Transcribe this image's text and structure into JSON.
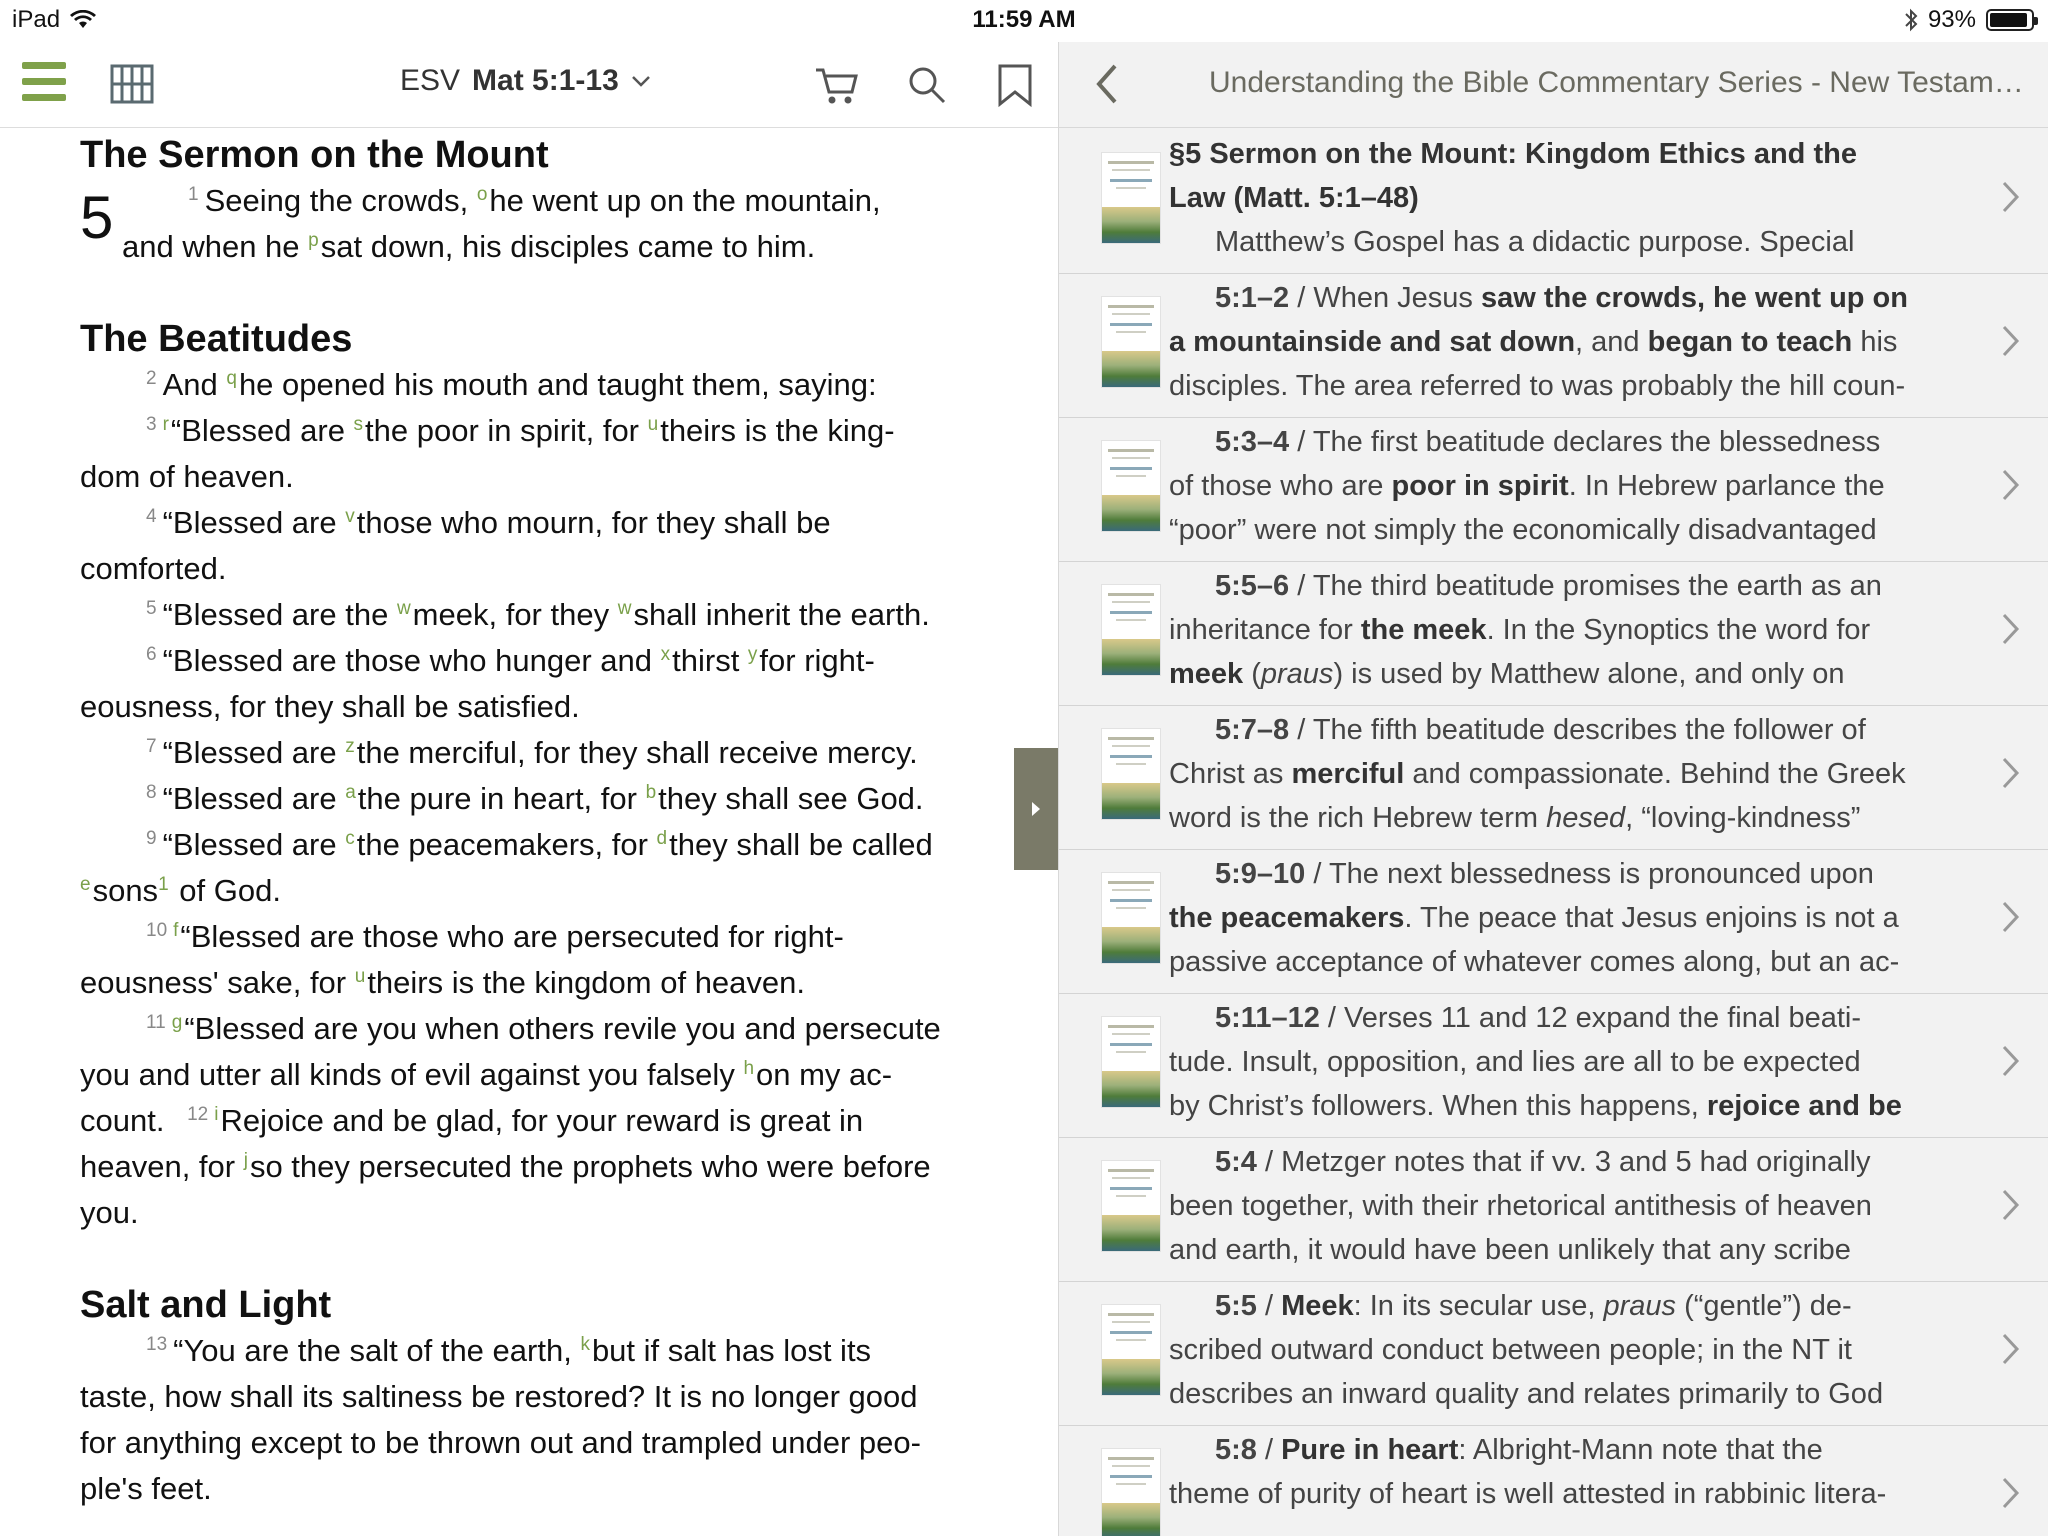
{
  "status_bar": {
    "device": "iPad",
    "time": "11:59 AM",
    "battery": "93%",
    "battery_level": 0.93
  },
  "left_toolbar": {
    "version": "ESV",
    "reference": "Mat 5:1-13"
  },
  "bible": {
    "heading1": "The Sermon on the Mount",
    "chapter": "5",
    "v1_num": "1",
    "v1_a": "Seeing the crowds, ",
    "v1_fn1": "o",
    "v1_b": "he went up on the mountain,",
    "v1_c": "and when he ",
    "v1_fn2": "p",
    "v1_d": "sat down, his disciples came to him.",
    "heading2": "The Beatitudes",
    "v2_num": "2",
    "v2_a": "And ",
    "v2_fn": "q",
    "v2_b": "he opened his mouth and taught them, saying:",
    "v3_num": "3",
    "v3_fn1": "r",
    "v3_a": "“Blessed are ",
    "v3_fn2": "s",
    "v3_b": "the poor in spirit, for ",
    "v3_fn3": "u",
    "v3_c": "theirs is the king-",
    "v3_d": "dom of heaven.",
    "v4_num": "4",
    "v4_a": "“Blessed are ",
    "v4_fn": "v",
    "v4_b": "those who mourn, for they shall be",
    "v4_c": "comforted.",
    "v5_num": "5",
    "v5_a": "“Blessed are the ",
    "v5_fn1": "w",
    "v5_b": "meek, for they ",
    "v5_fn2": "w",
    "v5_c": "shall inherit the earth.",
    "v6_num": "6",
    "v6_a": "“Blessed are those who hunger and ",
    "v6_fn1": "x",
    "v6_b": "thirst ",
    "v6_fn2": "y",
    "v6_c": "for right-",
    "v6_d": "eousness, for they shall be satisfied.",
    "v7_num": "7",
    "v7_a": "“Blessed are ",
    "v7_fn": "z",
    "v7_b": "the merciful, for they shall receive mercy.",
    "v8_num": "8",
    "v8_a": "“Blessed are ",
    "v8_fn1": "a",
    "v8_b": "the pure in heart, for ",
    "v8_fn2": "b",
    "v8_c": "they shall see God.",
    "v9_num": "9",
    "v9_a": "“Blessed are ",
    "v9_fn1": "c",
    "v9_b": "the peacemakers, for ",
    "v9_fn2": "d",
    "v9_c": "they shall be called",
    "v9_fn3": "e",
    "v9_d": "sons",
    "v9_fn4": "1",
    "v9_e": " of God.",
    "v10_num": "10",
    "v10_fn": "f",
    "v10_a": "“Blessed are those who are persecuted for right-",
    "v10_b": "eousness' sake, for ",
    "v10_fn2": "u",
    "v10_c": "theirs is the kingdom of heaven.",
    "v11_num": "11",
    "v11_fn": "g",
    "v11_a": "“Blessed are you when others revile you and persecute",
    "v11_b": "you and utter all kinds of evil against you falsely ",
    "v11_fn2": "h",
    "v11_c": "on my ac-",
    "v11_d": "count. ",
    "v12_num": "12",
    "v12_fn": "i",
    "v12_a": "Rejoice and be glad, for your reward is great in",
    "v12_b": "heaven, for ",
    "v12_fn2": "j",
    "v12_c": "so they persecuted the prophets who were before",
    "v12_d": "you.",
    "heading3": "Salt and Light",
    "v13_num": "13",
    "v13_a": "“You are the salt of the earth, ",
    "v13_fn": "k",
    "v13_b": "but if salt has lost its",
    "v13_c": "taste, how shall its saltiness be restored? It is no longer good",
    "v13_d": "for anything except to be thrown out and trampled under peo-",
    "v13_e": "ple's feet."
  },
  "commentary": {
    "title": "Understanding the Bible Commentary Series - New Testam…",
    "entries": [
      {
        "ref": "§5 Sermon on the Mount: Kingdom Ethics and the",
        "ref2": "Law (Matt. 5:1–48)",
        "l3": "Matthew’s Gospel has a didactic purpose. Special"
      },
      {
        "ref": "5:1–2",
        "a": " / When Jesus ",
        "b1": "saw the crowds, he went up on",
        "b2": "a mountainside and sat down",
        "c": ", and ",
        "b3": "began to teach",
        "d": " his",
        "l3": "disciples. The area referred to was probably the hill coun-"
      },
      {
        "ref": "5:3–4",
        "a": " / The first beatitude declares the blessedness",
        "l2a": "of those who are ",
        "b1": "poor in spirit",
        "l2b": ". In Hebrew parlance the",
        "l3": "“poor” were not simply the economically disadvantaged"
      },
      {
        "ref": "5:5–6",
        "a": " / The third beatitude promises the earth as an",
        "l2a": "inheritance for ",
        "b1": "the meek",
        "l2b": ". In the Synoptics the word for",
        "b2": "meek",
        "l3a": " (",
        "i1": "praus",
        "l3b": ") is used by Matthew alone, and only on"
      },
      {
        "ref": "5:7–8",
        "a": " / The fifth beatitude describes the follower of",
        "l2a": "Christ as ",
        "b1": "merciful",
        "l2b": " and compassionate. Behind the Greek",
        "l3a": "word is the rich Hebrew term ",
        "i1": "hesed",
        "l3b": ", “loving-kindness”"
      },
      {
        "ref": "5:9–10",
        "a": " / The next blessedness is pronounced upon",
        "b1": "the peacemakers",
        "l2b": ". The peace that Jesus enjoins is not a",
        "l3": "passive acceptance of whatever comes along, but an ac-"
      },
      {
        "ref": "5:11–12",
        "a": " / Verses 11 and 12 expand the final beati-",
        "l2": "tude. Insult, opposition, and lies are all to be expected",
        "l3a": "by Christ’s followers. When this happens, ",
        "b1": "rejoice and be"
      },
      {
        "ref": "5:4",
        "a": " / Metzger notes that if vv. 3 and 5 had originally",
        "l2": "been together, with their rhetorical antithesis of heaven",
        "l3": "and earth, it would have been unlikely that any scribe"
      },
      {
        "ref": "5:5",
        "a": " / ",
        "b1": "Meek",
        "c": ": In its secular use, ",
        "i1": "praus",
        "d": " (“gentle”) de-",
        "l2": "scribed outward conduct between people; in the NT it",
        "l3": "describes an inward quality and relates primarily to God"
      },
      {
        "ref": "5:8",
        "a": " / ",
        "b1": "Pure in heart",
        "c": ": Albright-Mann note that the",
        "l2": "theme of purity of heart is well attested in rabbinic litera-"
      }
    ]
  },
  "colors": {
    "accent_green": "#7fa14a",
    "handle": "#7a7a68",
    "right_bg": "#f2f2f2"
  }
}
